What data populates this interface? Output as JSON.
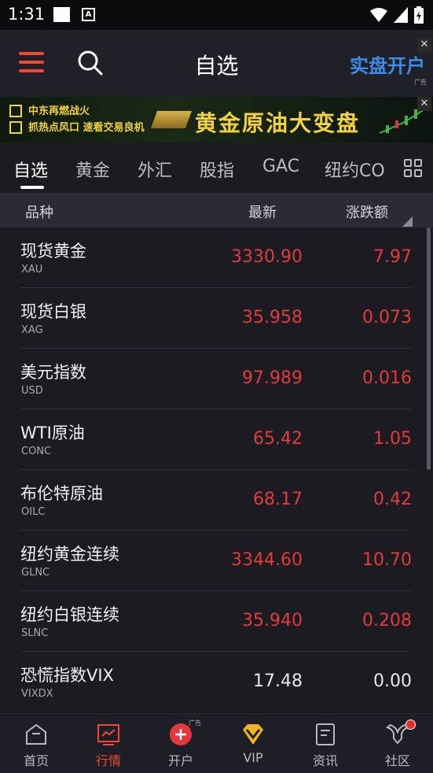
{
  "status_bar": {
    "time": "1:31",
    "notification_letter": "A"
  },
  "header": {
    "title": "自选",
    "open_account_label": "实盘开户",
    "ad_tag": "广告"
  },
  "banner": {
    "line1": "中东再燃战火",
    "line2": "抓热点风口 速看交易良机",
    "headline": "黄金原油大变盘"
  },
  "tabs": [
    "自选",
    "黄金",
    "外汇",
    "股指",
    "GAC",
    "纽约CO"
  ],
  "columns": {
    "name": "品种",
    "last": "最新",
    "change": "涨跌额"
  },
  "rows": [
    {
      "name": "现货黄金",
      "code": "XAU",
      "price": "3330.90",
      "change": "7.97",
      "direction": "up"
    },
    {
      "name": "现货白银",
      "code": "XAG",
      "price": "35.958",
      "change": "0.073",
      "direction": "up"
    },
    {
      "name": "美元指数",
      "code": "USD",
      "price": "97.989",
      "change": "0.016",
      "direction": "up"
    },
    {
      "name": "WTI原油",
      "code": "CONC",
      "price": "65.42",
      "change": "1.05",
      "direction": "up"
    },
    {
      "name": "布伦特原油",
      "code": "OILC",
      "price": "68.17",
      "change": "0.42",
      "direction": "up"
    },
    {
      "name": "纽约黄金连续",
      "code": "GLNC",
      "price": "3344.60",
      "change": "10.70",
      "direction": "up"
    },
    {
      "name": "纽约白银连续",
      "code": "SLNC",
      "price": "35.940",
      "change": "0.208",
      "direction": "up"
    },
    {
      "name": "恐慌指数VIX",
      "code": "VIXDX",
      "price": "17.48",
      "change": "0.00",
      "direction": "flat"
    }
  ],
  "bottom_nav": [
    {
      "label": "首页",
      "icon": "home-icon"
    },
    {
      "label": "行情",
      "icon": "market-chart-icon"
    },
    {
      "label": "开户",
      "icon": "plus-circle-icon",
      "ad_tag": "广告"
    },
    {
      "label": "VIP",
      "icon": "diamond-icon"
    },
    {
      "label": "资讯",
      "icon": "news-icon"
    },
    {
      "label": "社区",
      "icon": "community-icon"
    }
  ],
  "colors": {
    "accent": "#f0492f",
    "up": "#e23b3b",
    "link": "#3d8be8",
    "banner_text": "#f3d23a"
  }
}
